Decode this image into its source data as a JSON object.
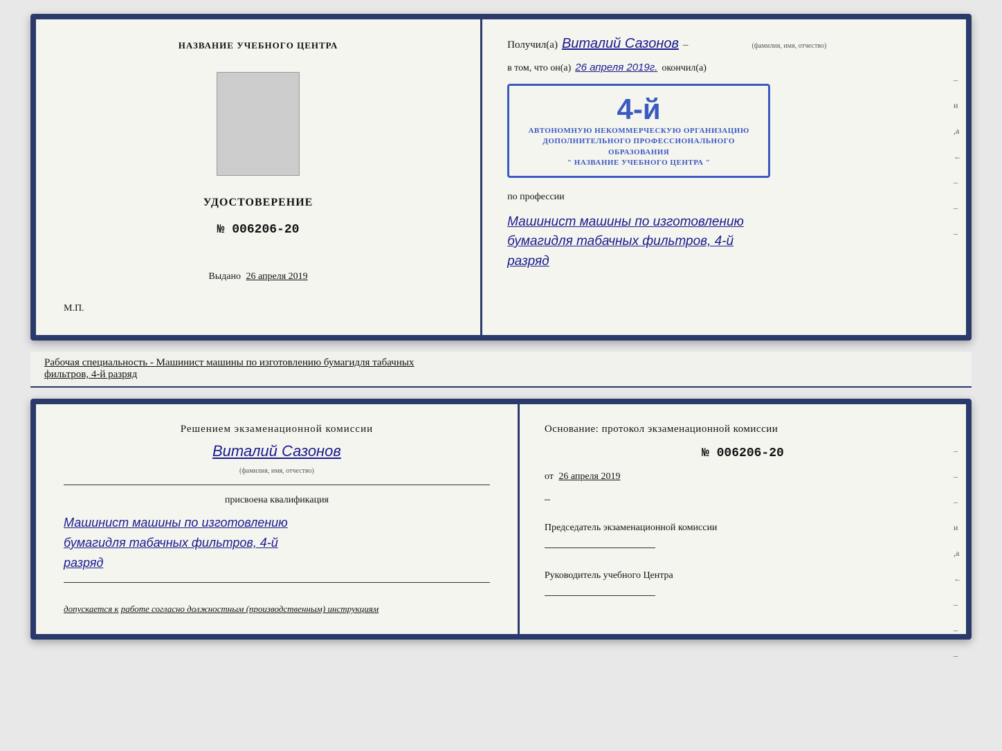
{
  "cert": {
    "left": {
      "title": "НАЗВАНИЕ УЧЕБНОГО ЦЕНТРА",
      "doc_title": "УДОСТОВЕРЕНИЕ",
      "doc_number": "№ 006206-20",
      "issued_label": "Выдано",
      "issued_date": "26 апреля 2019",
      "mp_label": "М.П."
    },
    "right": {
      "received_label": "Получил(а)",
      "name_handwritten": "Виталий Сазонов",
      "fio_sublabel": "(фамилия, имя, отчество)",
      "in_that_label": "в том, что он(а)",
      "date_handwritten": "26 апреля 2019г.",
      "finished_label": "окончил(а)",
      "stamp_big": "4-й",
      "stamp_line1": "АВТОНОМНУЮ НЕКОММЕРЧЕСКУЮ ОРГАНИЗАЦИЮ",
      "stamp_line2": "ДОПОЛНИТЕЛЬНОГО ПРОФЕССИОНАЛЬНОГО ОБРАЗОВАНИЯ",
      "stamp_line3": "\" НАЗВАНИЕ УЧЕБНОГО ЦЕНТРА \"",
      "profession_label": "по профессии",
      "profession_handwritten_1": "Машинист машины по изготовлению",
      "profession_handwritten_2": "бумагидля табачных фильтров, 4-й",
      "profession_handwritten_3": "разряд",
      "side_marks": [
        "-",
        "и",
        ",а",
        "←",
        "-",
        "-",
        "-"
      ]
    }
  },
  "subtitle": {
    "text": "Рабочая специальность - Машинист машины по изготовлению бумагидля табачных",
    "underlined": "фильтров, 4-й разряд"
  },
  "bottom": {
    "left": {
      "title": "Решением  экзаменационной  комиссии",
      "name_handwritten": "Виталий Сазонов",
      "fio_sublabel": "(фамилия, имя, отчество)",
      "assigned_label": "присвоена квалификация",
      "profession_handwritten_1": "Машинист машины по изготовлению",
      "profession_handwritten_2": "бумагидля табачных фильтров, 4-й",
      "profession_handwritten_3": "разряд",
      "допускается_label": "допускается к",
      "допускается_value": "работе согласно должностным (производственным) инструкциям"
    },
    "right": {
      "basis_label": "Основание:  протокол  экзаменационной  комиссии",
      "number": "№  006206-20",
      "date_prefix": "от",
      "date": "26 апреля 2019",
      "chairman_label": "Председатель экзаменационной комиссии",
      "head_label": "Руководитель учебного Центра",
      "side_marks": [
        "-",
        "-",
        "-",
        "и",
        ",а",
        "←",
        "-",
        "-",
        "-"
      ]
    }
  }
}
